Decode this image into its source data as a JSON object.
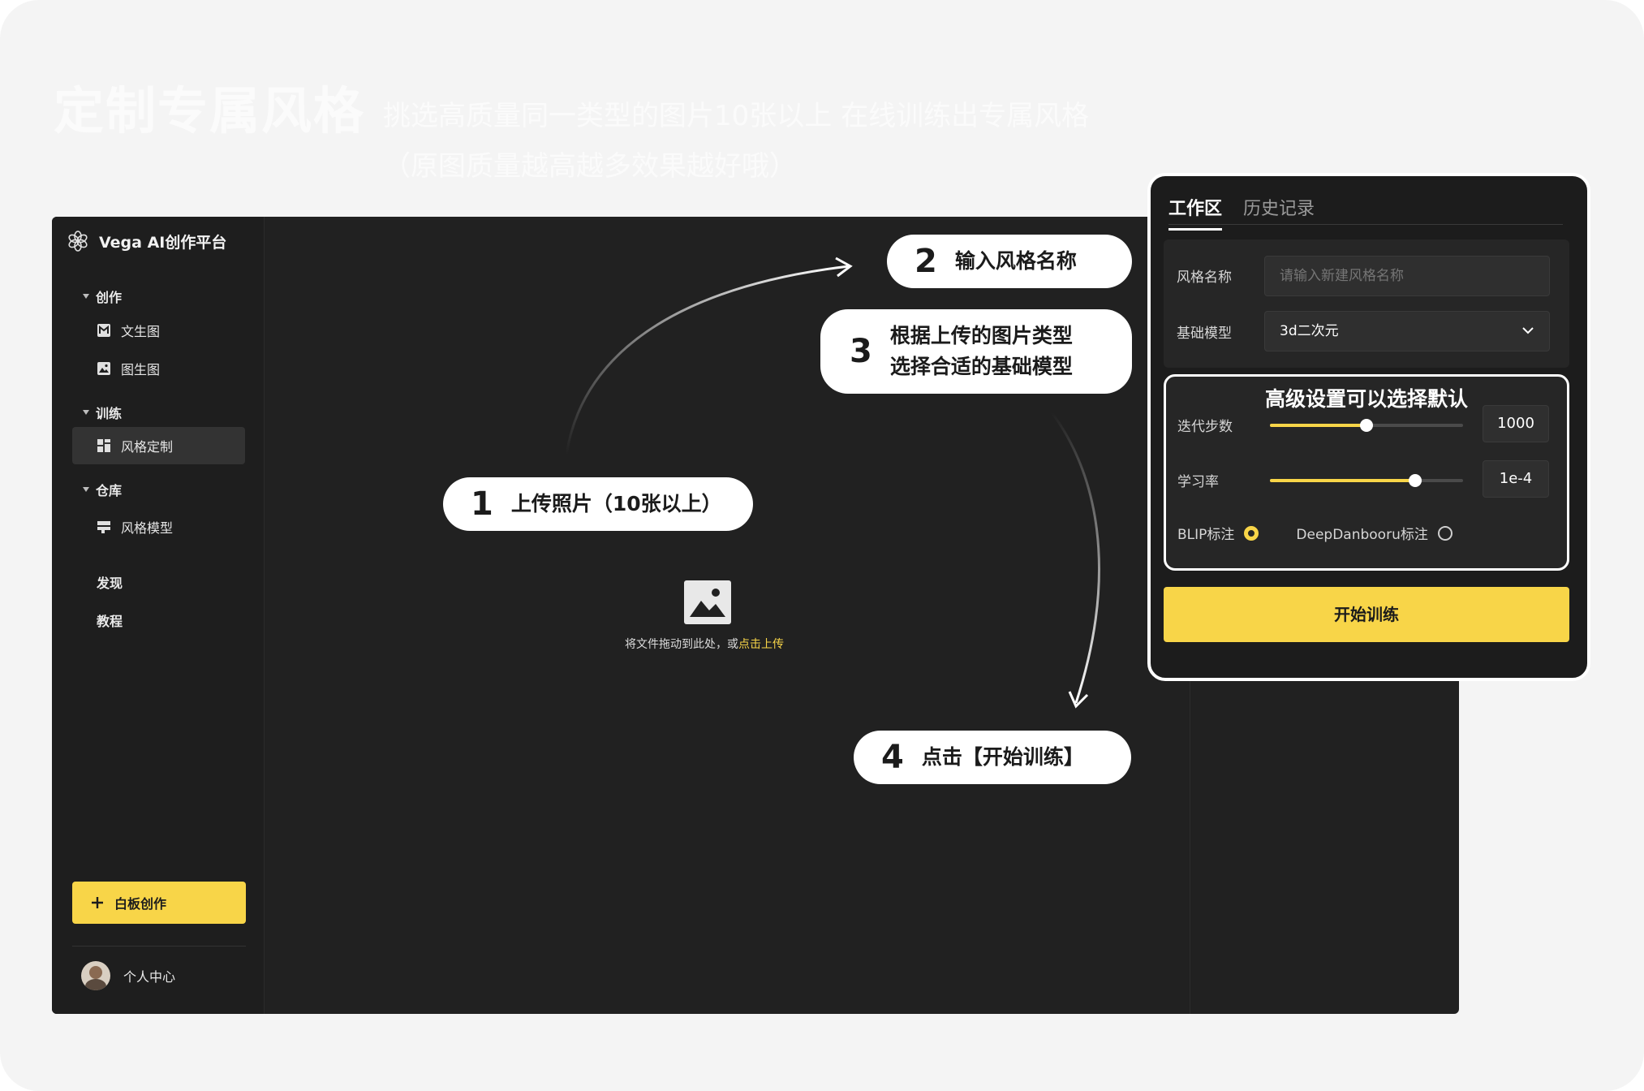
{
  "hero": {
    "title": "定制专属风格",
    "subtitle_line1": "挑选高质量同一类型的图片10张以上 在线训练出专属风格",
    "subtitle_line2": "（原图质量越高越多效果越好哦）"
  },
  "app": {
    "name": "Vega AI创作平台",
    "sidebar": {
      "sections": [
        {
          "label": "创作",
          "items": [
            {
              "label": "文生图",
              "icon": "text-to-image-icon"
            },
            {
              "label": "图生图",
              "icon": "image-to-image-icon"
            }
          ]
        },
        {
          "label": "训练",
          "items": [
            {
              "label": "风格定制",
              "icon": "dashboard-icon",
              "active": true
            }
          ]
        },
        {
          "label": "仓库",
          "items": [
            {
              "label": "风格模型",
              "icon": "model-icon"
            }
          ]
        }
      ],
      "plain_items": [
        "发现",
        "教程"
      ],
      "whiteboard_button": "白板创作",
      "profile_label": "个人中心"
    },
    "upload": {
      "text": "将文件拖动到此处，或",
      "link": "点击上传"
    }
  },
  "callouts": [
    {
      "num": "1",
      "text": "上传照片（10张以上）"
    },
    {
      "num": "2",
      "text": "输入风格名称"
    },
    {
      "num": "3",
      "line1": "根据上传的图片类型",
      "line2": "选择合适的基础模型"
    },
    {
      "num": "4",
      "text": "点击【开始训练】"
    }
  ],
  "panel": {
    "tabs": [
      "工作区",
      "历史记录"
    ],
    "style_name_label": "风格名称",
    "style_name_placeholder": "请输入新建风格名称",
    "base_model_label": "基础模型",
    "base_model_value": "3d二次元",
    "advanced_title": "高级设置可以选择默认",
    "iterations_label": "迭代步数",
    "iterations_value": "1000",
    "iterations_fraction": 0.5,
    "lr_label": "学习率",
    "lr_value": "1e-4",
    "lr_fraction": 0.75,
    "radio_blip": "BLIP标注",
    "radio_deep": "DeepDanbooru标注",
    "start_button": "开始训练"
  },
  "colors": {
    "accent": "#f8d548",
    "dark_bg": "#212121",
    "panel_bg": "#1c1c1c"
  }
}
